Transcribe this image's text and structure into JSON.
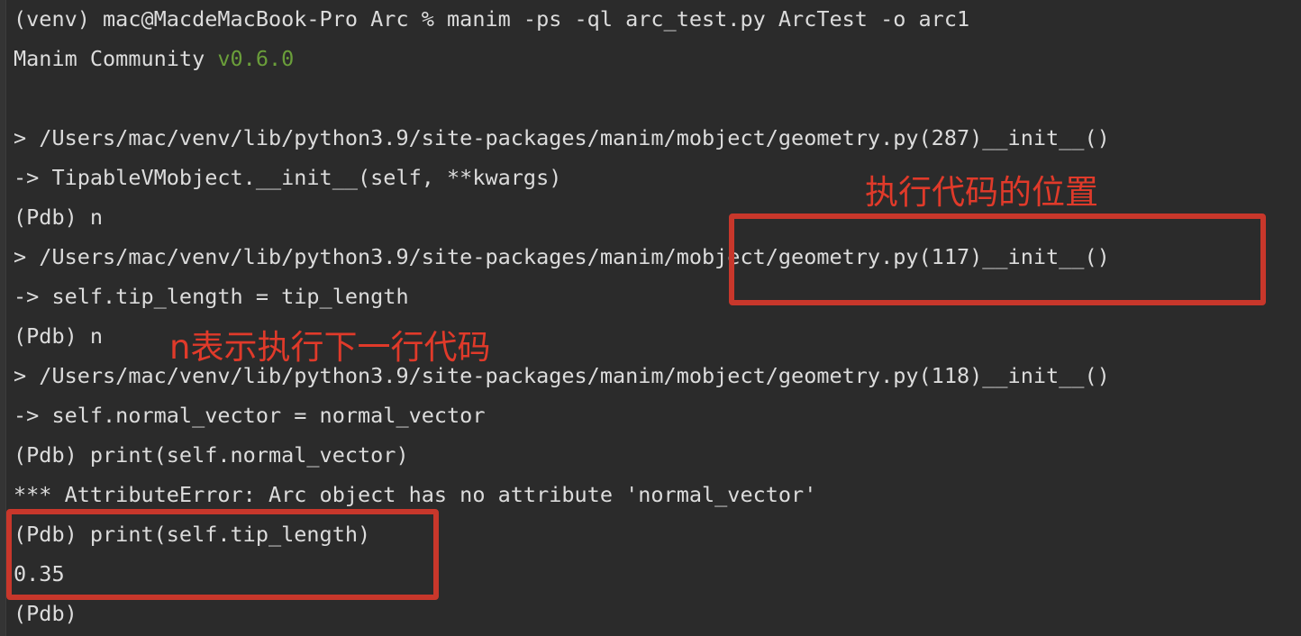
{
  "terminal": {
    "lines": [
      "(venv) mac@MacdeMacBook-Pro Arc % manim -ps -ql arc_test.py ArcTest -o arc1",
      "Manim Community ",
      "",
      "> /Users/mac/venv/lib/python3.9/site-packages/manim/mobject/geometry.py(287)__init__()",
      "-> TipableVMobject.__init__(self, **kwargs)",
      "(Pdb) n",
      "> /Users/mac/venv/lib/python3.9/site-packages/manim/mobject/geometry.py(117)__init__()",
      "-> self.tip_length = tip_length",
      "(Pdb) n",
      "> /Users/mac/venv/lib/python3.9/site-packages/manim/mobject/geometry.py(118)__init__()",
      "-> self.normal_vector = normal_vector",
      "(Pdb) print(self.normal_vector)",
      "*** AttributeError: Arc object has no attribute 'normal_vector'",
      "(Pdb) print(self.tip_length)",
      "0.35",
      "(Pdb)"
    ],
    "version": "v0.6.0"
  },
  "annotations": {
    "exec_location": "执行代码的位置",
    "n_next_line": "n表示执行下一行代码"
  },
  "colors": {
    "background": "#2b2b2b",
    "text": "#dcdcdc",
    "version_green": "#6a9e3a",
    "annotation_red": "#e03a2a",
    "box_red": "#c8372b"
  }
}
